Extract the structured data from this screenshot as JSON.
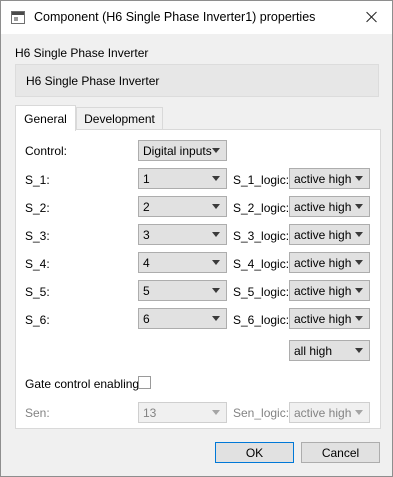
{
  "window": {
    "title": "Component (H6 Single Phase Inverter1) properties"
  },
  "component": {
    "type_label": "H6 Single Phase Inverter",
    "name_value": "H6 Single Phase Inverter"
  },
  "tabs": [
    {
      "label": "General",
      "active": true
    },
    {
      "label": "Development",
      "active": false
    }
  ],
  "general": {
    "control_label": "Control:",
    "control_value": "Digital inputs",
    "switches": [
      {
        "label": "S_1:",
        "value": "1",
        "logic_label": "S_1_logic:",
        "logic_value": "active high"
      },
      {
        "label": "S_2:",
        "value": "2",
        "logic_label": "S_2_logic:",
        "logic_value": "active high"
      },
      {
        "label": "S_3:",
        "value": "3",
        "logic_label": "S_3_logic:",
        "logic_value": "active high"
      },
      {
        "label": "S_4:",
        "value": "4",
        "logic_label": "S_4_logic:",
        "logic_value": "active high"
      },
      {
        "label": "S_5:",
        "value": "5",
        "logic_label": "S_5_logic:",
        "logic_value": "active high"
      },
      {
        "label": "S_6:",
        "value": "6",
        "logic_label": "S_6_logic:",
        "logic_value": "active high"
      }
    ],
    "all_logic_value": "all high",
    "gate_control_label": "Gate control enabling:",
    "gate_control_checked": false,
    "sen_label": "Sen:",
    "sen_value": "13",
    "sen_logic_label": "Sen_logic:",
    "sen_logic_value": "active high"
  },
  "buttons": {
    "ok": "OK",
    "cancel": "Cancel"
  },
  "colors": {
    "accent": "#0078d7",
    "control_face": "#e1e1e1",
    "disabled_text": "#838383"
  },
  "icons": {
    "app": "component-icon",
    "close": "close-icon",
    "dropdown": "chevron-down-icon"
  }
}
